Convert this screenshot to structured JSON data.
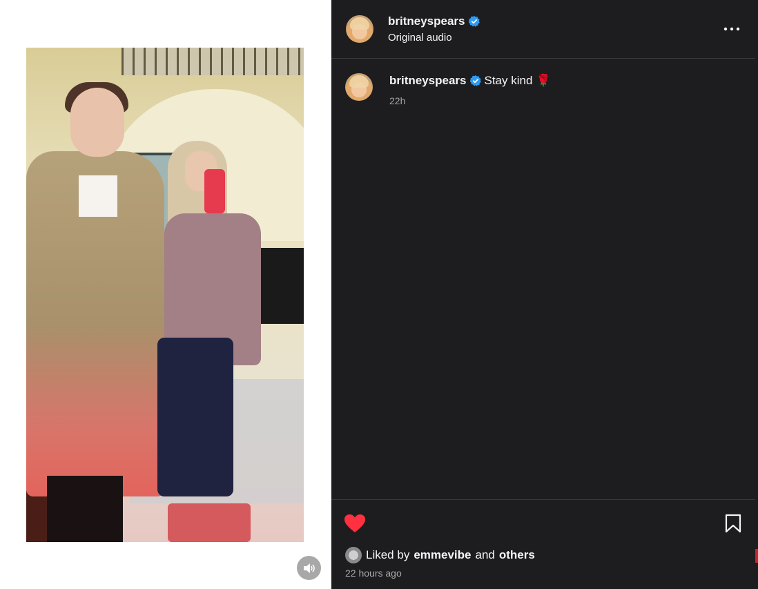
{
  "post": {
    "username": "britneyspears",
    "audio_label": "Original audio",
    "caption_text": "Stay kind",
    "caption_emoji": "🌹",
    "caption_time": "22h",
    "liked_by_prefix": "Liked by",
    "liked_by_user": "emmevibe",
    "liked_by_and": "and",
    "liked_by_others": "others",
    "posted_ago": "22 hours ago"
  },
  "icons": {
    "verified": "verified-badge-icon",
    "more": "more-options-icon",
    "like": "heart-icon",
    "save": "bookmark-icon",
    "mute": "speaker-icon"
  },
  "colors": {
    "panel_bg": "#1d1d1f",
    "verified_blue": "#2f9bf4",
    "like_red": "#ff3040",
    "muted_text": "#a8a8a8"
  }
}
